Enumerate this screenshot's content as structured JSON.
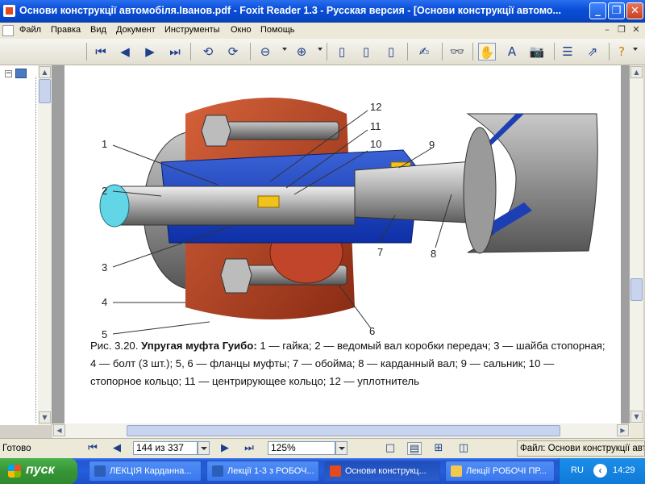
{
  "window": {
    "title": "Основи конструкції автомобіля.Іванов.pdf - Foxit Reader 1.3 - Русская версия  - [Основи конструкції автомо..."
  },
  "menu": [
    "Файл",
    "Правка",
    "Вид",
    "Документ",
    "Инструменты",
    "Окно",
    "Помощь"
  ],
  "document": {
    "callouts": [
      "1",
      "2",
      "3",
      "4",
      "5",
      "6",
      "7",
      "8",
      "9",
      "10",
      "11",
      "12"
    ],
    "caption": {
      "prefix": "Рис. 3.20. ",
      "title": "Упругая муфта Гуибо:",
      "body": " 1 — гайка; 2 — ведомый вал коробки передач; 3 — шайба стопорная; 4 — болт (3 шт.); 5, 6 — фланцы муфты; 7 — обойма; 8 — карданный вал; 9 — сальник; 10 — стопорное кольцо; 11 — центрирующее кольцо; 12 — уплотнитель"
    }
  },
  "status": {
    "ready": "Готово",
    "page": "144 из 337",
    "zoom": "125%",
    "file": "Файл: Основи конструкції авто"
  },
  "taskbar": {
    "start": "пуск",
    "tasks": [
      {
        "label": "ЛЕКЦІЯ Карданна...",
        "active": false
      },
      {
        "label": "Лекції 1-3 з РОБОЧ...",
        "active": false
      },
      {
        "label": "Основи конструкц...",
        "active": true
      },
      {
        "label": "Лекції РОБОЧІ ПР...",
        "active": false
      }
    ],
    "lang": "RU",
    "clock": "14:29"
  }
}
